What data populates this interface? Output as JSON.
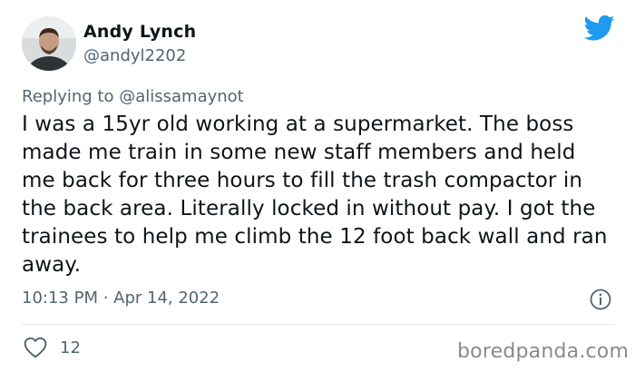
{
  "author": {
    "name": "Andy Lynch",
    "handle": "@andyl2202"
  },
  "reply": {
    "prefix": "Replying to",
    "mention": "@alissamaynot"
  },
  "tweet_text": "I was a 15yr old working at a supermarket. The boss made me train in some new staff members and held me back for three hours to fill the trash compactor in the back area. Literally locked in without pay. I got the trainees to help me climb the 12 foot back wall and ran away.",
  "timestamp": "10:13 PM · Apr 14, 2022",
  "likes": "12",
  "watermark": "boredpanda.com",
  "colors": {
    "twitter_blue": "#1d9bf0",
    "secondary_text": "#536471",
    "primary_text": "#0f1419"
  },
  "icons": {
    "brand": "twitter-bird-icon",
    "info": "info-icon",
    "like": "heart-icon"
  }
}
